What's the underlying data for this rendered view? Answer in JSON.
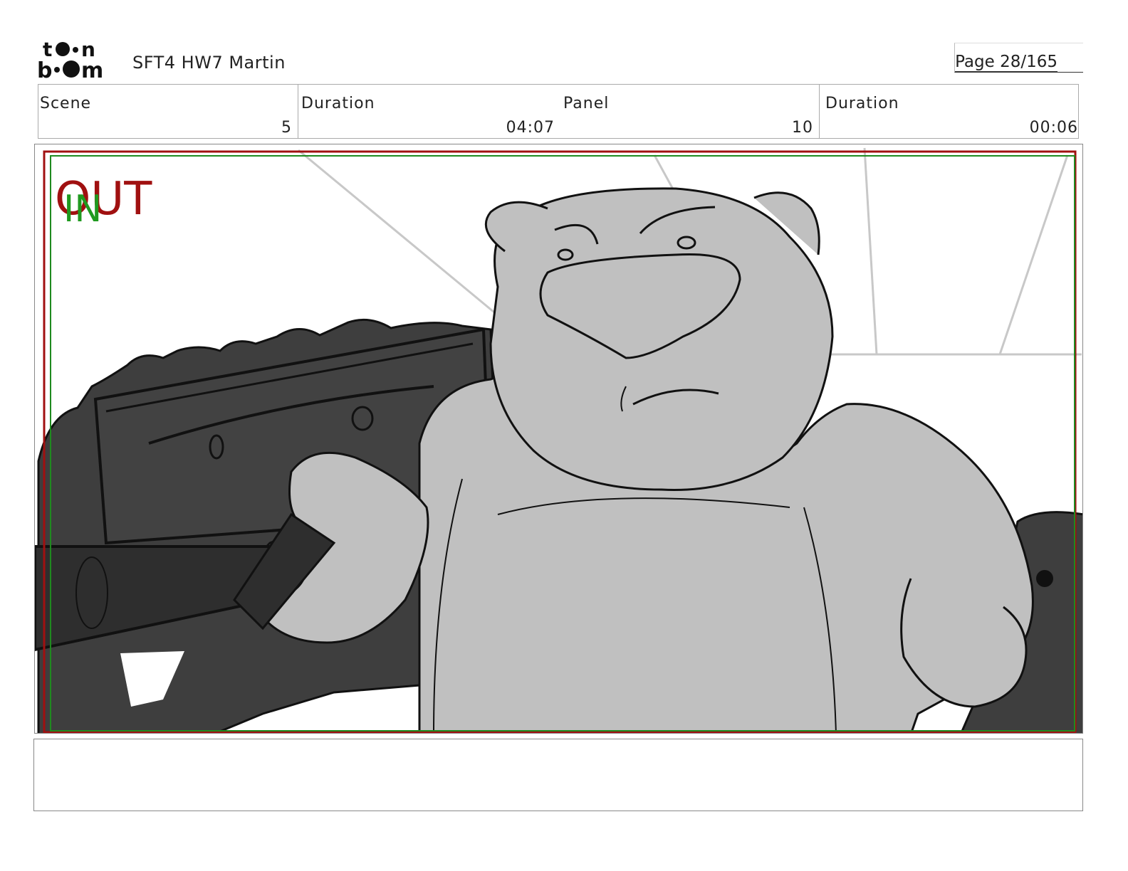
{
  "header": {
    "logo_top": "to•n",
    "logo_bottom": "b••m",
    "project_title": "SFT4 HW7 Martin",
    "page_label": "Page 28/165"
  },
  "info": {
    "scene_label": "Scene",
    "scene_value": "5",
    "scene_duration_label": "Duration",
    "scene_duration_value": "04:07",
    "panel_label": "Panel",
    "panel_value": "10",
    "panel_duration_label": "Duration",
    "panel_duration_value": "00:06"
  },
  "frame": {
    "out_label": "OUT",
    "in_label": "IN",
    "out_color": "#a01010",
    "in_color": "#1f9a1f"
  },
  "notes": {
    "text": ""
  }
}
